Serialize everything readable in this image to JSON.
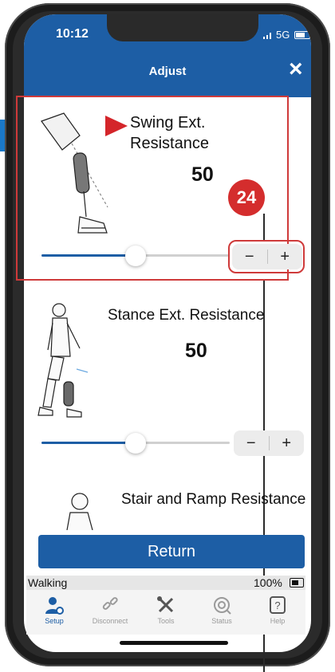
{
  "status_bar": {
    "time": "10:12",
    "network": "5G"
  },
  "nav": {
    "title": "Adjust",
    "close_icon": "close-icon"
  },
  "settings": [
    {
      "title": "Swing Ext. Resistance",
      "value": "50",
      "slider_percent": 50,
      "decrease_label": "−",
      "increase_label": "+"
    },
    {
      "title": "Stance Ext. Resistance",
      "value": "50",
      "slider_percent": 50,
      "decrease_label": "−",
      "increase_label": "+"
    },
    {
      "title": "Stair and Ramp Resistance"
    }
  ],
  "callout": {
    "step_number": "24"
  },
  "return_button": "Return",
  "device_status": {
    "mode": "Walking",
    "battery": "100%"
  },
  "tabs": [
    {
      "label": "Setup",
      "icon": "user-settings-icon",
      "active": true
    },
    {
      "label": "Disconnect",
      "icon": "broken-link-icon",
      "active": false
    },
    {
      "label": "Tools",
      "icon": "tools-icon",
      "active": false
    },
    {
      "label": "Status",
      "icon": "status-icon",
      "active": false
    },
    {
      "label": "Help",
      "icon": "help-icon",
      "active": false
    }
  ],
  "colors": {
    "brand_blue": "#1d5ea5",
    "annotation_red": "#d42d2d"
  }
}
